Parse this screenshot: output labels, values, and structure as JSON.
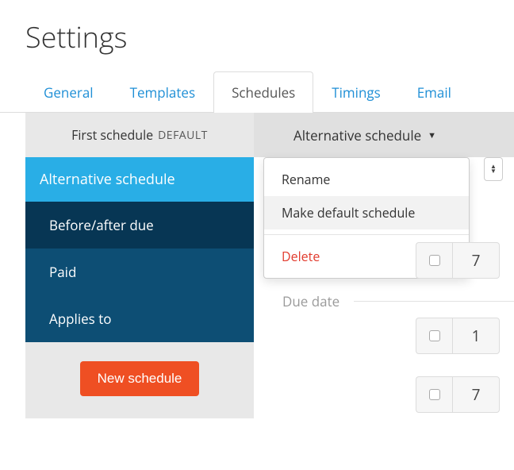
{
  "page_title": "Settings",
  "tabs": {
    "general": "General",
    "templates": "Templates",
    "schedules": "Schedules",
    "timings": "Timings",
    "email": "Email"
  },
  "sidebar": {
    "first_schedule": "First schedule",
    "default_badge": "DEFAULT",
    "items": {
      "header": "Alternative schedule",
      "before_after": "Before/after due",
      "paid": "Paid",
      "applies_to": "Applies to"
    },
    "new_schedule": "New schedule"
  },
  "alt_tab": {
    "label": "Alternative schedule"
  },
  "dropdown": {
    "rename": "Rename",
    "make_default": "Make default schedule",
    "delete": "Delete"
  },
  "due_date_label": "Due date",
  "rows": [
    {
      "value": "7"
    },
    {
      "value": "1"
    },
    {
      "value": "7"
    }
  ]
}
